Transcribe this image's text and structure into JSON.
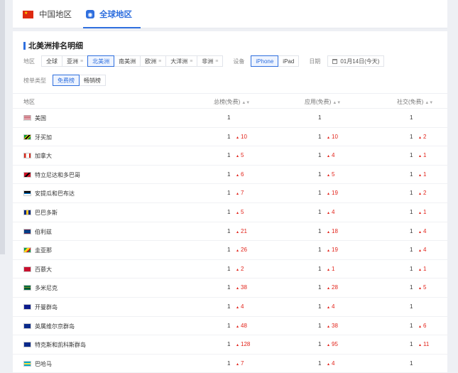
{
  "tabs": [
    {
      "label": "中国地区",
      "active": false
    },
    {
      "label": "全球地区",
      "active": true
    }
  ],
  "section_title": "北美洲排名明细",
  "filters": {
    "region_label": "地区",
    "regions": [
      "全球",
      "亚洲",
      "北美洲",
      "南美洲",
      "欧洲",
      "大洋洲",
      "非洲"
    ],
    "active_region": "北美洲",
    "device_label": "设备",
    "devices": [
      "iPhone",
      "iPad"
    ],
    "active_device": "iPhone",
    "date_label": "日期",
    "date_value": "01月14日(今天)",
    "chart_type_label": "榜单类型",
    "chart_types": [
      "免费榜",
      "畅销榜"
    ],
    "active_chart_type": "免费榜"
  },
  "table": {
    "headers": [
      "地区",
      "总榜(免费)",
      "应用(免费)",
      "社交(免费)"
    ],
    "rows": [
      {
        "country": "美国",
        "flag": "us-flag",
        "total": "1",
        "total_up": "",
        "app": "1",
        "app_up": "",
        "social": "1",
        "social_up": ""
      },
      {
        "country": "牙买加",
        "flag": "jamaica-flag",
        "total": "1",
        "total_up": "10",
        "app": "1",
        "app_up": "10",
        "social": "1",
        "social_up": "2"
      },
      {
        "country": "加拿大",
        "flag": "canada-flag",
        "total": "1",
        "total_up": "5",
        "app": "1",
        "app_up": "4",
        "social": "1",
        "social_up": "1"
      },
      {
        "country": "特立尼达和多巴哥",
        "flag": "trinidad-flag",
        "total": "1",
        "total_up": "6",
        "app": "1",
        "app_up": "5",
        "social": "1",
        "social_up": "1"
      },
      {
        "country": "安提瓜和巴布达",
        "flag": "antigua-flag",
        "total": "1",
        "total_up": "7",
        "app": "1",
        "app_up": "19",
        "social": "1",
        "social_up": "2"
      },
      {
        "country": "巴巴多斯",
        "flag": "barbados-flag",
        "total": "1",
        "total_up": "5",
        "app": "1",
        "app_up": "4",
        "social": "1",
        "social_up": "1"
      },
      {
        "country": "伯利兹",
        "flag": "belize-flag",
        "total": "1",
        "total_up": "21",
        "app": "1",
        "app_up": "18",
        "social": "1",
        "social_up": "4"
      },
      {
        "country": "圭亚那",
        "flag": "guyana-flag",
        "total": "1",
        "total_up": "26",
        "app": "1",
        "app_up": "19",
        "social": "1",
        "social_up": "4"
      },
      {
        "country": "百慕大",
        "flag": "bermuda-flag",
        "total": "1",
        "total_up": "2",
        "app": "1",
        "app_up": "1",
        "social": "1",
        "social_up": "1"
      },
      {
        "country": "多米尼克",
        "flag": "dominica-flag",
        "total": "1",
        "total_up": "38",
        "app": "1",
        "app_up": "28",
        "social": "1",
        "social_up": "5"
      },
      {
        "country": "开曼群岛",
        "flag": "cayman-flag",
        "total": "1",
        "total_up": "4",
        "app": "1",
        "app_up": "4",
        "social": "1",
        "social_up": ""
      },
      {
        "country": "英属维尔京群岛",
        "flag": "bvi-flag",
        "total": "1",
        "total_up": "48",
        "app": "1",
        "app_up": "38",
        "social": "1",
        "social_up": "6"
      },
      {
        "country": "特克斯和凯科斯群岛",
        "flag": "turks-caicos-flag",
        "total": "1",
        "total_up": "128",
        "app": "1",
        "app_up": "95",
        "social": "1",
        "social_up": "11"
      },
      {
        "country": "巴哈马",
        "flag": "bahamas-flag",
        "total": "1",
        "total_up": "7",
        "app": "1",
        "app_up": "4",
        "social": "1",
        "social_up": ""
      }
    ]
  },
  "colors": {
    "accent": "#2f6fde",
    "up": "#e2231a"
  }
}
